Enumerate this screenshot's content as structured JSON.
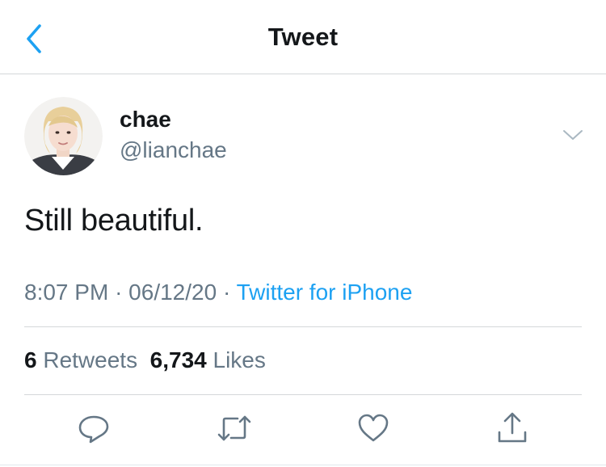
{
  "header": {
    "title": "Tweet",
    "back_icon": "chevron-left-icon"
  },
  "author": {
    "display_name": "chae",
    "handle": "@lianchae",
    "avatar_icon": "avatar"
  },
  "tweet": {
    "text": "Still beautiful.",
    "time": "8:07 PM",
    "date": "06/12/20",
    "separator": "·",
    "source": "Twitter for iPhone"
  },
  "stats": {
    "retweets_count": "6",
    "retweets_label": "Retweets",
    "likes_count": "6,734",
    "likes_label": "Likes"
  },
  "actions": [
    "reply-icon",
    "retweet-icon",
    "like-icon",
    "share-icon"
  ],
  "colors": {
    "accent": "#1da1f2",
    "secondary_text": "#657786",
    "primary_text": "#14171a",
    "divider": "#d4d7da"
  }
}
